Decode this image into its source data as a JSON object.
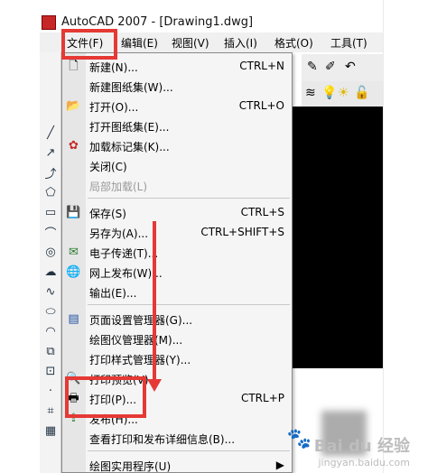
{
  "window": {
    "title": "AutoCAD 2007 - [Drawing1.dwg]"
  },
  "menubar": {
    "items": [
      {
        "label": "文件(F)"
      },
      {
        "label": "编辑(E)"
      },
      {
        "label": "视图(V)"
      },
      {
        "label": "插入(I)"
      },
      {
        "label": "格式(O)"
      },
      {
        "label": "工具(T)"
      }
    ]
  },
  "file_menu": {
    "items": [
      {
        "label": "新建(N)...",
        "shortcut": "CTRL+N",
        "icon": "new-file-icon",
        "enabled": true
      },
      {
        "label": "新建图纸集(W)...",
        "shortcut": "",
        "icon": "",
        "enabled": true
      },
      {
        "label": "打开(O)...",
        "shortcut": "CTRL+O",
        "icon": "open-folder-icon",
        "enabled": true
      },
      {
        "label": "打开图纸集(E)...",
        "shortcut": "",
        "icon": "",
        "enabled": true
      },
      {
        "label": "加载标记集(K)...",
        "shortcut": "",
        "icon": "markup-icon",
        "enabled": true
      },
      {
        "label": "关闭(C)",
        "shortcut": "",
        "icon": "",
        "enabled": true
      },
      {
        "label": "局部加载(L)",
        "shortcut": "",
        "icon": "",
        "enabled": false
      },
      {
        "label": "保存(S)",
        "shortcut": "CTRL+S",
        "icon": "save-icon",
        "enabled": true
      },
      {
        "label": "另存为(A)...",
        "shortcut": "CTRL+SHIFT+S",
        "icon": "",
        "enabled": true
      },
      {
        "label": "电子传递(T)...",
        "shortcut": "",
        "icon": "etransmit-icon",
        "enabled": true
      },
      {
        "label": "网上发布(W)...",
        "shortcut": "",
        "icon": "publish-web-icon",
        "enabled": true
      },
      {
        "label": "输出(E)...",
        "shortcut": "",
        "icon": "",
        "enabled": true
      },
      {
        "label": "页面设置管理器(G)...",
        "shortcut": "",
        "icon": "page-setup-icon",
        "enabled": true
      },
      {
        "label": "绘图仪管理器(M)...",
        "shortcut": "",
        "icon": "",
        "enabled": true
      },
      {
        "label": "打印样式管理器(Y)...",
        "shortcut": "",
        "icon": "",
        "enabled": true
      },
      {
        "label": "打印预览(V)",
        "shortcut": "",
        "icon": "plot-preview-icon",
        "enabled": true
      },
      {
        "label": "打印(P)...",
        "shortcut": "CTRL+P",
        "icon": "plot-icon",
        "enabled": true
      },
      {
        "label": "发布(H)...",
        "shortcut": "",
        "icon": "publish-icon",
        "enabled": true
      },
      {
        "label": "查看打印和发布详细信息(B)...",
        "shortcut": "",
        "icon": "",
        "enabled": true
      },
      {
        "label": "绘图实用程序(U)",
        "shortcut": "",
        "icon": "",
        "enabled": true
      }
    ]
  },
  "watermark": {
    "brand": "Bai du 经验",
    "sub": "jingyan.baidu.com"
  },
  "colors": {
    "highlight": "#e53935",
    "canvas": "#000000"
  }
}
